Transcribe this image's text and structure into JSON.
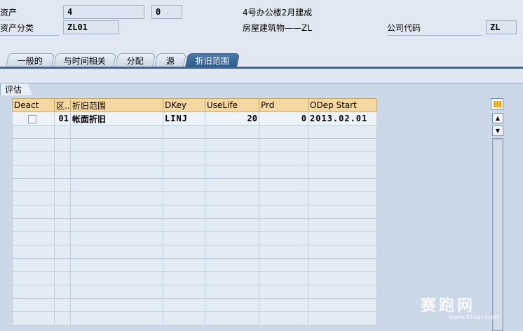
{
  "header": {
    "asset_label": "资产",
    "asset_number": "4",
    "sub_number": "0",
    "description": "4号办公楼2月建成",
    "asset_class_label": "资产分类",
    "asset_class": "ZL01",
    "asset_class_desc": "房屋建筑物——ZL",
    "company_code_label": "公司代码",
    "company_code": "ZL"
  },
  "tabs": [
    {
      "label": "一般的",
      "active": false
    },
    {
      "label": "与时间相关",
      "active": false
    },
    {
      "label": "分配",
      "active": false
    },
    {
      "label": "源",
      "active": false
    },
    {
      "label": "折旧范围",
      "active": true
    }
  ],
  "group": {
    "title": "评估"
  },
  "table": {
    "columns": [
      "Deact",
      "区...",
      "折旧范围",
      "DKey",
      "UseLife",
      "Prd",
      "ODep Start"
    ],
    "rows": [
      {
        "area": "01",
        "name": "帐面折旧",
        "dkey": "LINJ",
        "uselife": "20",
        "prd": "0",
        "odep_start": "2013.02.01"
      }
    ]
  },
  "watermark": {
    "text": "赛跑网",
    "url": "www.91sai.com"
  },
  "colors": {
    "active_tab": "#2d5a8c",
    "header_cell": "#f5d8a1",
    "background": "#e1e8f1"
  }
}
